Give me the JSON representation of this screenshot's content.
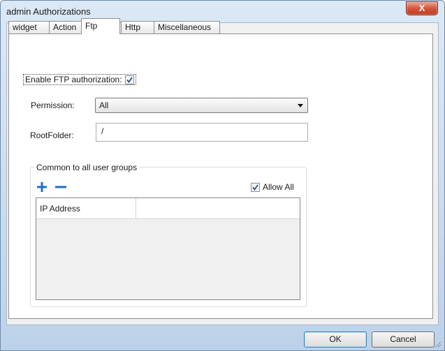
{
  "window": {
    "title": "admin Authorizations",
    "close_glyph": "X"
  },
  "tabs": [
    {
      "label": "widget",
      "active": false
    },
    {
      "label": "Action",
      "active": false
    },
    {
      "label": "Ftp",
      "active": true
    },
    {
      "label": "Http",
      "active": false
    },
    {
      "label": "Miscellaneous",
      "active": false
    }
  ],
  "ftp": {
    "enable_label": "Enable FTP authorization:",
    "enable_checked": true,
    "permission_label": "Permission:",
    "permission_value": "All",
    "rootfolder_label": "RootFolder:",
    "rootfolder_value": "/"
  },
  "common": {
    "group_title": "Common to all user groups",
    "add_icon": "plus-icon",
    "remove_icon": "minus-icon",
    "allow_all_label": "Allow All",
    "allow_all_checked": true,
    "columns": [
      "IP Address",
      ""
    ],
    "rows": []
  },
  "buttons": {
    "ok": "OK",
    "cancel": "Cancel"
  },
  "colors": {
    "accent_blue": "#1a6fd0",
    "title_bar": "#c9dcef",
    "close_red": "#c13b1e"
  }
}
